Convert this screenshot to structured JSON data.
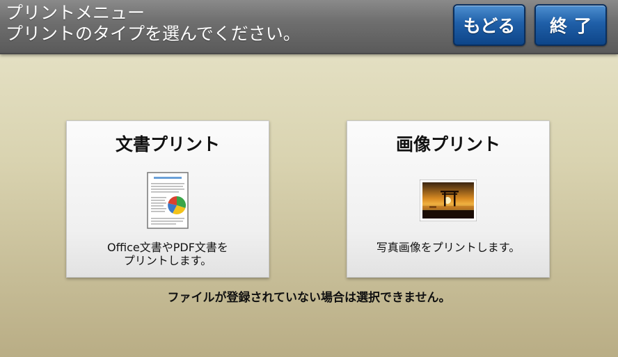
{
  "header": {
    "title_line1": "プリントメニュー",
    "title_line2": "プリントのタイプを選んでください。",
    "back_label": "もどる",
    "end_label": "終了"
  },
  "cards": {
    "document": {
      "title": "文書プリント",
      "desc_line1": "Office文書やPDF文書を",
      "desc_line2": "プリントします。",
      "icon": "document-pie-chart-icon"
    },
    "photo": {
      "title": "画像プリント",
      "desc_line1": "写真画像をプリントします。",
      "icon": "photo-torii-sunset-icon"
    }
  },
  "footer_note": "ファイルが登録されていない場合は選択できません。",
  "colors": {
    "header_bg": "#6f6f6f",
    "button_blue": "#1f5fa8",
    "background": "#d9d3b0"
  }
}
